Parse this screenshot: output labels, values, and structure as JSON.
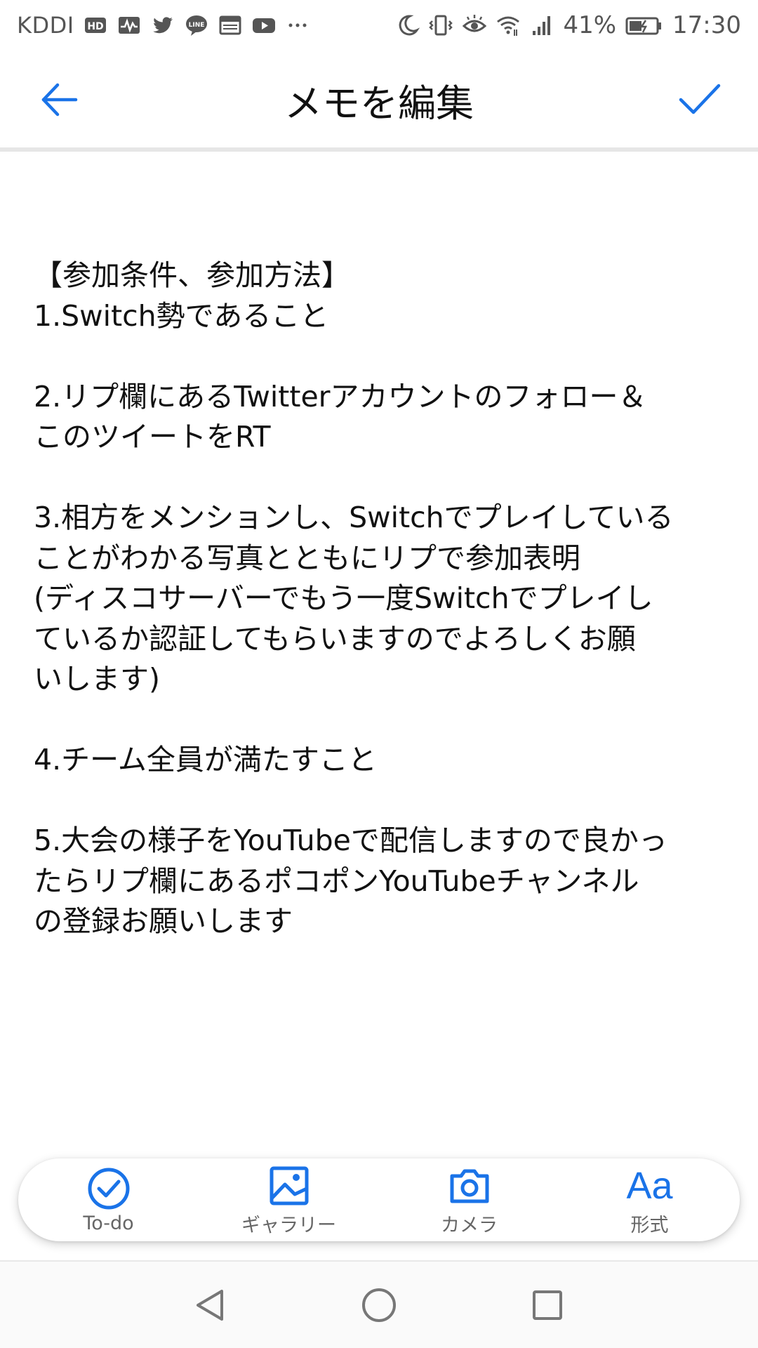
{
  "status_bar": {
    "carrier": "KDDI",
    "battery_percent": "41%",
    "time": "17:30",
    "left_icons": [
      "hd-icon",
      "activity-icon",
      "twitter-icon",
      "line-icon",
      "news-icon",
      "youtube-icon",
      "more-icon"
    ],
    "right_icons": [
      "moon-icon",
      "vibrate-icon",
      "eye-icon",
      "wifi-icon",
      "signal-icon",
      "battery-icon"
    ]
  },
  "app_bar": {
    "title": "メモを編集",
    "back_icon": "arrow-left-icon",
    "save_icon": "check-icon",
    "accent_color": "#1a73e8"
  },
  "note": {
    "lines": [
      "【参加条件、参加方法】",
      "1.Switch勢であること",
      "",
      "2.リプ欄にあるTwitterアカウントのフォロー＆",
      "このツイートをRT",
      "",
      "3.相方をメンションし、Switchでプレイしている",
      "ことがわかる写真とともにリプで参加表明",
      "(ディスコサーバーでもう一度Switchでプレイし",
      "ているか認証してもらいますのでよろしくお願",
      "いします)",
      "",
      "4.チーム全員が満たすこと",
      "",
      "5.大会の様子をYouTubeで配信しますので良かっ",
      "たらリプ欄にあるポコポンYouTubeチャンネル",
      "の登録お願いします"
    ]
  },
  "toolbar": {
    "todo_label": "To-do",
    "gallery_label": "ギャラリー",
    "camera_label": "カメラ",
    "format_label": "形式",
    "format_glyph": "Aa"
  },
  "nav_bar": {
    "buttons": [
      "back-triangle-icon",
      "home-circle-icon",
      "recents-square-icon"
    ]
  }
}
